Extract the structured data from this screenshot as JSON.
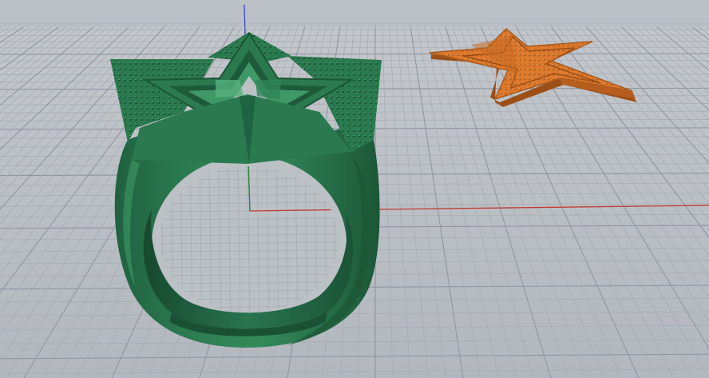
{
  "viewport": {
    "projection": "perspective",
    "background_color": "#b9bec4",
    "grid": {
      "visible": true,
      "minor_line_color": "#a7adb4",
      "major_line_color": "#8f969e"
    },
    "axes": {
      "x_axis_color": "#c0392b",
      "y_axis_color": "#2e8b3f",
      "z_axis_color": "#3a46c8"
    }
  },
  "objects": [
    {
      "name": "star-signet-ring",
      "material_color": "#2b7a4f",
      "highlight_color": "#3f9966",
      "shadow_color": "#1b5535",
      "selected": false
    },
    {
      "name": "star-top-piece",
      "material_color": "#e07b2d",
      "highlight_color": "#f0a050",
      "shadow_color": "#9c4f17",
      "selected": false
    }
  ]
}
